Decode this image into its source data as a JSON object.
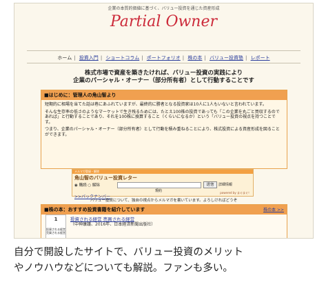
{
  "site": {
    "tagline": "企業の本質的価値に基づく、バリュー投資を通じた資産形成",
    "logo": "Partial Owner"
  },
  "nav": {
    "items": [
      {
        "label": "ホーム",
        "link": false
      },
      {
        "label": "投資入門",
        "link": true
      },
      {
        "label": "ショートコラム",
        "link": true
      },
      {
        "label": "ポートフォリオ",
        "link": true
      },
      {
        "label": "株の本",
        "link": true
      },
      {
        "label": "バリュー投資塾",
        "link": true
      },
      {
        "label": "レポート",
        "link": true
      }
    ]
  },
  "headline": {
    "line1": "株式市場で資産を築きたければ、バリュー投資の実践により",
    "line2": "企業のパーシャル・オーナー（部分所有者）として行動することです"
  },
  "intro": {
    "title": "■はじめに：管理人の角山智より",
    "p1": "短期的に相場を当てた話は巷にあふれていますが、最終的に勝者となる投資家は10人に1人もいないと言われています。",
    "p2": "そんな生存率の低さのようなマーケットで生き残るためには、たとえ100株の投資であっても「この企業を丸ごと買収するのであれば」と行動することであり、それを100株に換算すること（くらいになるか）という「バリュー投資の視点を持つことです。",
    "p3": "つまり、企業のパーシャル・オーナー（部分所有者）として行動を積み重ねることにより、株式投資による資産形成を図ることができます。"
  },
  "newsletter": {
    "header": "メルマガ登録・解除",
    "title": "角山智のバリュー投資レター",
    "radio_subscribe": "購読",
    "radio_unsubscribe": "解除",
    "submit": "送信",
    "cancel": "詳細情報",
    "note": "規約",
    "back_numbers": ">>バックナンバー",
    "powered": "powered by まぐまぐ！"
  },
  "newsletter_note": "バリュー投資について、独自の視点からメルマガを書いています。よろしければどうぞ",
  "books": {
    "title": "■株の本：おすすめ投資書籍を紹介しています",
    "more": "株の本 >>",
    "rank": "1",
    "thumb_label": "投資される経営 売買される経営",
    "book_title": "投資される経営 売買される経営",
    "book_meta": "（中神康議、2016年、日本経済新聞出版社）"
  },
  "caption": {
    "line1": "自分で開設したサイトで、バリュー投資のメリット",
    "line2": "やノウハウなどについても解説。ファンも多い。"
  }
}
